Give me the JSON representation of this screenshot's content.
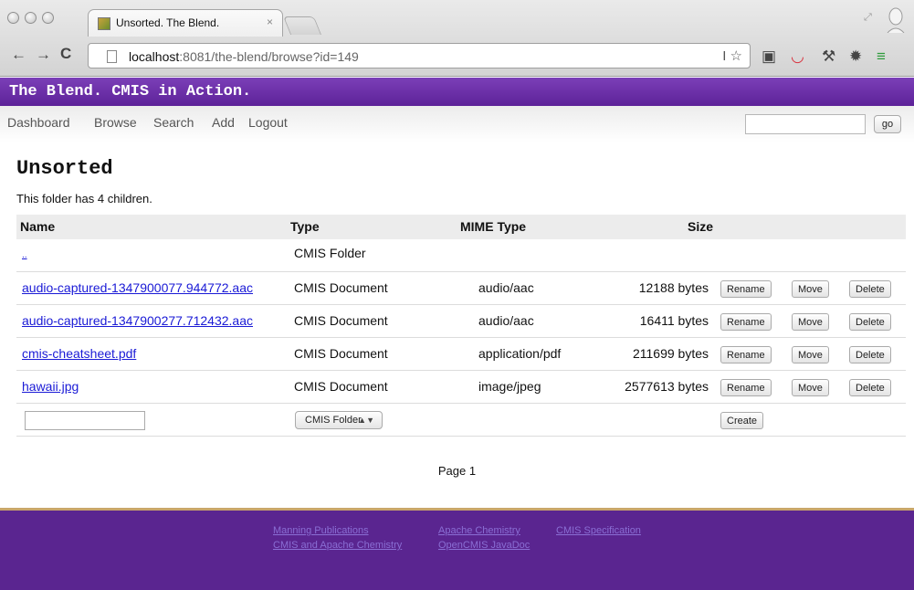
{
  "browser": {
    "tab_title": "Unsorted. The Blend.",
    "tab_close": "×",
    "url_host": "localhost",
    "url_rest": ":8081/the-blend/browse?id=149"
  },
  "site": {
    "title": "The Blend. CMIS in Action.",
    "nav": [
      "Dashboard",
      "Browse",
      "Search",
      "Add",
      "Logout"
    ],
    "search_placeholder": "",
    "go_label": "go"
  },
  "folder": {
    "name": "Unsorted",
    "children_note": "This folder has 4 children.",
    "columns": [
      "Name",
      "Type",
      "MIME Type",
      "Size"
    ],
    "parent_row": {
      "name": "..",
      "type": "CMIS Folder"
    },
    "rows": [
      {
        "name": "audio-captured-1347900077.944772.aac",
        "type": "CMIS Document",
        "mime": "audio/aac",
        "size": "12188 bytes"
      },
      {
        "name": "audio-captured-1347900277.712432.aac",
        "type": "CMIS Document",
        "mime": "audio/aac",
        "size": "16411 bytes"
      },
      {
        "name": "cmis-cheatsheet.pdf",
        "type": "CMIS Document",
        "mime": "application/pdf",
        "size": "211699 bytes"
      },
      {
        "name": "hawaii.jpg",
        "type": "CMIS Document",
        "mime": "image/jpeg",
        "size": "2577613 bytes"
      }
    ],
    "actions": {
      "rename": "Rename",
      "move": "Move",
      "delete": "Delete"
    },
    "create": {
      "type_selected": "CMIS Folder",
      "button": "Create"
    },
    "pager": "Page 1"
  },
  "footer": {
    "links": [
      "Manning Publications",
      "Apache Chemistry",
      "CMIS Specification",
      "CMIS and Apache Chemistry",
      "OpenCMIS JavaDoc"
    ]
  }
}
